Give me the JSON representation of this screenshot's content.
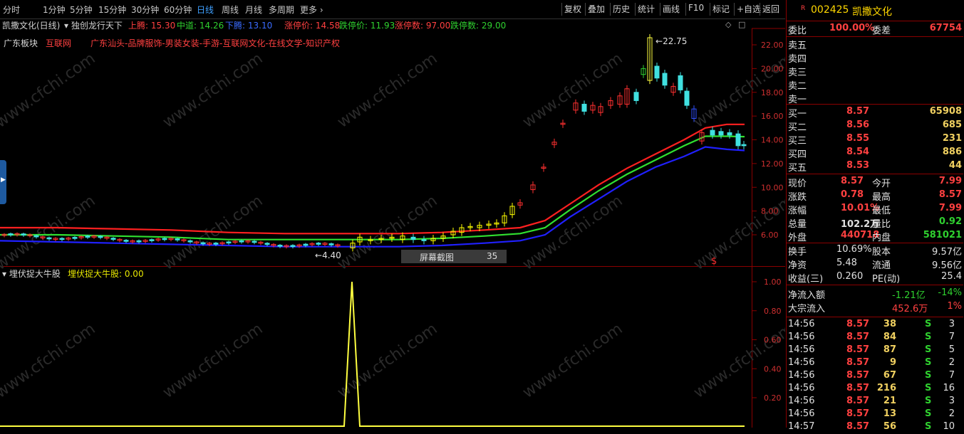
{
  "toolbar": {
    "tabs": [
      "分时",
      "1分钟",
      "5分钟",
      "15分钟",
      "30分钟",
      "60分钟",
      "日线",
      "周线",
      "月线",
      "多周期",
      "更多"
    ],
    "active_tab": "日线",
    "buttons": [
      "复权",
      "叠加",
      "历史",
      "统计",
      "画线",
      "F10",
      "标记",
      "+自选",
      "返回"
    ]
  },
  "chart": {
    "title": "凯撒文化(日线)",
    "indicator_name": "独创龙行天下",
    "upper_label": "上腾:",
    "upper_value": "15.30",
    "mid_label": "中道:",
    "mid_value": "14.26",
    "lower_label": "下腾:",
    "lower_value": "13.10",
    "limit_up_label": "涨停价:",
    "limit_up_value": "14.58",
    "limit_down_label": "跌停价:",
    "limit_down_value": "11.93",
    "limit_up_count_label": "涨停数:",
    "limit_up_count": "97.00",
    "limit_down_count_label": "跌停数:",
    "limit_down_count": "29.00",
    "sector_label": "广东板块",
    "sector_tag": "互联网",
    "concepts": "广东汕头-品牌服饰-男装女装-手游-互联网文化-在线文学-知识产权",
    "high_mark": "22.75",
    "low_mark": "4.40",
    "y_ticks": [
      "22.00",
      "20.00",
      "18.00",
      "16.00",
      "14.00",
      "12.00",
      "10.00",
      "8.00",
      "6.00"
    ],
    "sub_indicator": "埋伏捉大牛股",
    "sub_value_label": "埋伏捉大牛股: 0.00",
    "sub_y_ticks": [
      "1.00",
      "0.80",
      "0.60",
      "0.40",
      "0.20"
    ],
    "screenshot_label": "屏幕截图",
    "screenshot_num": "35",
    "dollar_mark": "$",
    "watermark": "www.cfchi.com"
  },
  "chart_data": {
    "type": "line",
    "title": "凯撒文化(日线)",
    "ylim": [
      4,
      23.5
    ],
    "series": [
      {
        "name": "上腾",
        "values": [
          6.6,
          6.6,
          6.5,
          6.4,
          6.2,
          6.1,
          6.1,
          6.1,
          6.2,
          6.4,
          6.6,
          7.2,
          8.6,
          10.2,
          11.6,
          12.8,
          14.0,
          15.0,
          15.3,
          15.3
        ]
      },
      {
        "name": "中道",
        "values": [
          6.0,
          6.0,
          5.9,
          5.8,
          5.6,
          5.6,
          5.6,
          5.6,
          5.7,
          5.9,
          6.1,
          6.6,
          8.1,
          9.7,
          11.1,
          12.3,
          13.5,
          14.3,
          14.3,
          14.26
        ]
      },
      {
        "name": "下腾",
        "values": [
          5.5,
          5.4,
          5.3,
          5.2,
          5.1,
          5.0,
          5.0,
          5.0,
          5.1,
          5.3,
          5.5,
          6.0,
          7.5,
          9.0,
          10.5,
          11.7,
          12.6,
          13.4,
          13.2,
          13.1
        ]
      }
    ],
    "high": 22.75,
    "low": 4.4
  },
  "quote": {
    "badge": "R",
    "code": "002425",
    "name": "凯撒文化",
    "weibi_label": "委比",
    "weibi": "100.00%",
    "weicha_label": "委差",
    "weicha": "67754",
    "sells": [
      "卖五",
      "卖四",
      "卖三",
      "卖二",
      "卖一"
    ],
    "buys": [
      {
        "label": "买一",
        "price": "8.57",
        "vol": "65908"
      },
      {
        "label": "买二",
        "price": "8.56",
        "vol": "685"
      },
      {
        "label": "买三",
        "price": "8.55",
        "vol": "231"
      },
      {
        "label": "买四",
        "price": "8.54",
        "vol": "886"
      },
      {
        "label": "买五",
        "price": "8.53",
        "vol": "44"
      }
    ],
    "stats": [
      {
        "l1": "现价",
        "v1": "8.57",
        "l2": "今开",
        "v2": "7.99",
        "c1": "red",
        "c2": "red"
      },
      {
        "l1": "涨跌",
        "v1": "0.78",
        "l2": "最高",
        "v2": "8.57",
        "c1": "red",
        "c2": "red"
      },
      {
        "l1": "涨幅",
        "v1": "10.01%",
        "l2": "最低",
        "v2": "7.99",
        "c1": "red",
        "c2": "red"
      },
      {
        "l1": "总量",
        "v1": "102.2万",
        "l2": "量比",
        "v2": "0.92",
        "c1": "white",
        "c2": "green"
      },
      {
        "l1": "外盘",
        "v1": "440718",
        "l2": "内盘",
        "v2": "581021",
        "c1": "red",
        "c2": "green"
      }
    ],
    "stats2": [
      {
        "l1": "换手",
        "v1": "10.69%",
        "l2": "股本",
        "v2": "9.57亿"
      },
      {
        "l1": "净资",
        "v1": "5.48",
        "l2": "流通",
        "v2": "9.56亿"
      },
      {
        "l1": "收益(三)",
        "v1": "0.260",
        "l2": "PE(动)",
        "v2": "25.4"
      }
    ],
    "flow": [
      {
        "label": "净流入额",
        "val": "-1.21亿",
        "pct": "-14%",
        "c": "green"
      },
      {
        "label": "大宗流入",
        "val": "452.6万",
        "pct": "1%",
        "c": "red"
      }
    ],
    "ticks": [
      {
        "t": "14:56",
        "p": "8.57",
        "v": "38",
        "s": "S",
        "n": "3"
      },
      {
        "t": "14:56",
        "p": "8.57",
        "v": "84",
        "s": "S",
        "n": "7"
      },
      {
        "t": "14:56",
        "p": "8.57",
        "v": "87",
        "s": "S",
        "n": "5"
      },
      {
        "t": "14:56",
        "p": "8.57",
        "v": "9",
        "s": "S",
        "n": "2"
      },
      {
        "t": "14:56",
        "p": "8.57",
        "v": "67",
        "s": "S",
        "n": "7"
      },
      {
        "t": "14:56",
        "p": "8.57",
        "v": "216",
        "s": "S",
        "n": "16"
      },
      {
        "t": "14:56",
        "p": "8.57",
        "v": "21",
        "s": "S",
        "n": "3"
      },
      {
        "t": "14:56",
        "p": "8.57",
        "v": "13",
        "s": "S",
        "n": "2"
      },
      {
        "t": "14:57",
        "p": "8.57",
        "v": "56",
        "s": "S",
        "n": "10"
      }
    ]
  }
}
